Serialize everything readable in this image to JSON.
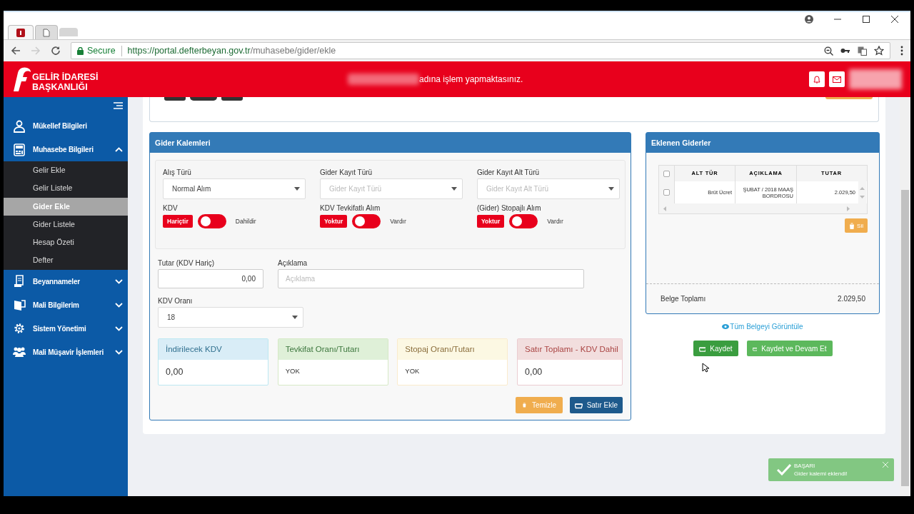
{
  "browser": {
    "tabs": [
      {
        "selected": true
      },
      {
        "selected": false
      }
    ],
    "secure_label": "Secure",
    "url_host": "https://portal.defterbeyan.gov.tr",
    "url_path": "/muhasebe/gider/ekle"
  },
  "header": {
    "logo_lines": [
      "GELİR İDARESİ",
      "BAŞKANLIĞI"
    ],
    "notice": "adına işlem yapmaktasınız."
  },
  "sidebar": {
    "items": [
      {
        "label": "Mükellef Bilgileri",
        "kind": "person"
      },
      {
        "label": "Muhasebe Bilgileri",
        "kind": "calculator",
        "expanded": true,
        "children": [
          {
            "label": "Gelir Ekle",
            "selected": false
          },
          {
            "label": "Gelir Listele",
            "selected": false
          },
          {
            "label": "Gider Ekle",
            "selected": true
          },
          {
            "label": "Gider Listele",
            "selected": false
          },
          {
            "label": "Hesap Özeti",
            "selected": false
          },
          {
            "label": "Defter",
            "selected": false
          }
        ]
      },
      {
        "label": "Beyannameler",
        "kind": "document",
        "expanded": false
      },
      {
        "label": "Mali Bilgilerim",
        "kind": "wallet",
        "expanded": false
      },
      {
        "label": "Sistem Yönetimi",
        "kind": "gear",
        "expanded": false
      },
      {
        "label": "Mali Müşavir İşlemleri",
        "kind": "people",
        "expanded": false
      }
    ]
  },
  "gider_kalemleri": {
    "title": "Gider Kalemleri",
    "selects": [
      {
        "label": "Alış Türü",
        "value": "Normal Alım"
      },
      {
        "label": "Gider Kayıt Türü",
        "placeholder": "Gider Kayıt Türü"
      },
      {
        "label": "Gider Kayıt Alt Türü",
        "placeholder": "Gider Kayıt Alt Türü"
      }
    ],
    "toggles": [
      {
        "label": "KDV",
        "off_label": "Hariçtir",
        "on_label": "Dahildir",
        "on": false
      },
      {
        "label": "KDV Tevkifatlı Alım",
        "off_label": "Yoktur",
        "on_label": "Vardır",
        "on": false
      },
      {
        "label": "(Gider) Stopajlı Alım",
        "off_label": "Yoktur",
        "on_label": "Vardır",
        "on": false
      }
    ],
    "tutar": {
      "label": "Tutar (KDV Hariç)",
      "value": "0,00"
    },
    "aciklama": {
      "label": "Açıklama",
      "placeholder": "Açıklama"
    },
    "kdv_orani": {
      "label": "KDV Oranı",
      "value": "18"
    },
    "summaries": [
      {
        "title": "İndirilecek KDV",
        "value": "0,00",
        "kind": "info"
      },
      {
        "title": "Tevkifat Oranı/Tutarı",
        "value": "YOK",
        "kind": "success"
      },
      {
        "title": "Stopaj Oranı/Tutarı",
        "value": "YOK",
        "kind": "warning"
      },
      {
        "title": "Satır Toplamı - KDV Dahil",
        "value": "0,00",
        "kind": "danger"
      }
    ],
    "buttons": [
      {
        "label": "Temizle",
        "kind": "clear"
      },
      {
        "label": "Satır Ekle",
        "kind": "add"
      }
    ]
  },
  "eklenen_giderler": {
    "title": "Eklenen Giderler",
    "header_checked": false,
    "columns": [
      "ALT TÜR",
      "AÇIKLAMA",
      "TUTAR"
    ],
    "rows": [
      {
        "checked": false,
        "cells": [
          "Brüt Ücret",
          "ŞUBAT / 2018 MAAŞ BORDROSU",
          "2.029,50"
        ]
      }
    ],
    "delete_button": "Sil",
    "total_label": "Belge Toplamı",
    "total_value": "2.029,50"
  },
  "view_link": "Tüm Belgeyi Görüntüle",
  "actions": [
    {
      "label": "Kaydet",
      "kind": "save"
    },
    {
      "label": "Kaydet ve Devam Et",
      "kind": "save_continue"
    }
  ],
  "toast": {
    "title": "BAŞARI",
    "message": "Gider kalemi eklendi!"
  }
}
